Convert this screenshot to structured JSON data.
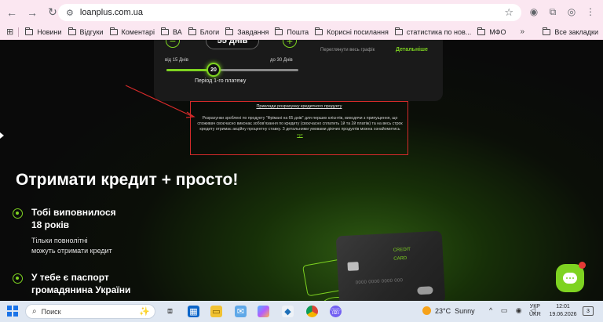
{
  "browser": {
    "url": "loanplus.com.ua",
    "bookmarks": [
      {
        "label": "Новини"
      },
      {
        "label": "Відгуки"
      },
      {
        "label": "Коментарі"
      },
      {
        "label": "ВА"
      },
      {
        "label": "Блоги"
      },
      {
        "label": "Завдання"
      },
      {
        "label": "Пошта"
      },
      {
        "label": "Корисні посилання"
      },
      {
        "label": "статистика по нов..."
      },
      {
        "label": "МФО"
      }
    ],
    "more_label": "»",
    "all_bookmarks_label": "Все закладки"
  },
  "calculator": {
    "minus": "−",
    "plus": "+",
    "days_value": "55 днів",
    "range_min": "від 15 Днів",
    "range_max": "до 30 Днів",
    "slider_value": "20",
    "slider_fraction": 0.33,
    "period_label": "Період 1-го платежу",
    "graph_link": "Переглянути весь графік",
    "details_link": "Детальніше"
  },
  "info_box": {
    "title": "Приклади розрахунку кредитного продукту",
    "text": "Розрахунки зроблені по продукту \"Фрімані на 65 днів\" для перших клієнтів, виходячи з припущення, що споживач своєчасно виконає зобов'язання по кредиту (своєчасно сплатить 1й та 2й платіж) та на весь строк кредиту отримає акційну процентну ставку. З детальними умовами діючих продуктів можна ознайомитись",
    "link": "тут"
  },
  "hero": {
    "headline": "Отримати кредит + просто!",
    "features": [
      {
        "title_line1": "Тобі виповнилося",
        "title_line2": "18 років",
        "sub_line1": "Тільки повнолітні",
        "sub_line2": "можуть отримати кредит"
      },
      {
        "title_line1": "У тебе є паспорт",
        "title_line2": "громадянина України"
      }
    ]
  },
  "card": {
    "line1": "CREDIT",
    "line2": "CARD",
    "number": "0000 0000 0000 000"
  },
  "taskbar": {
    "search_placeholder": "Поиск",
    "weather_temp": "23°C",
    "weather_text": "Sunny",
    "lang_line1": "УКР",
    "lang_line2": "UKR",
    "time": "12:01",
    "date": "19.06.2026",
    "notifications": "3"
  },
  "colors": {
    "accent": "#7ed321",
    "highlight_border": "#d42a2a",
    "browser_chrome": "#fbe7f1"
  }
}
